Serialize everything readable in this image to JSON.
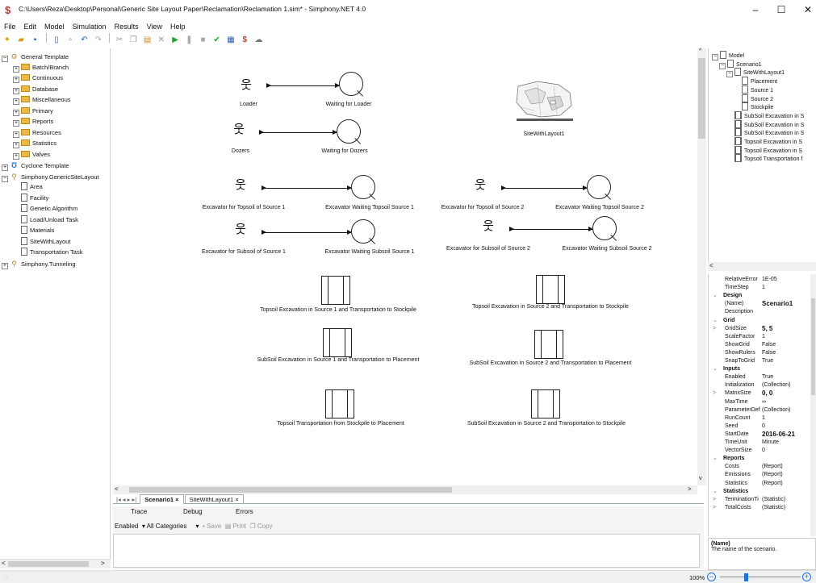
{
  "title": {
    "icon": "simphony-dollar-icon",
    "text": "C:\\Users\\Reza\\Desktop\\Personal\\Generic Site Layout Paper\\Reclamation\\Reclamation 1.sim* - Simphony.NET 4.0",
    "minimize": "–",
    "maximize": "☐",
    "close": "✕"
  },
  "menu": [
    "File",
    "Edit",
    "Model",
    "Simulation",
    "Results",
    "View",
    "Help"
  ],
  "toolbar": {
    "icons": [
      "new-file-icon",
      "open-folder-icon",
      "save-icon",
      "add-element-icon",
      "page-icon",
      "undo-icon",
      "redo-icon",
      "cut-icon",
      "copy-icon",
      "paste-icon",
      "delete-icon",
      "run-icon",
      "pause-icon",
      "stop-icon",
      "check-icon",
      "report-icon",
      "dollar-icon",
      "cloud-icon"
    ]
  },
  "left_tree": [
    {
      "label": "General Template",
      "icon": "template-icon",
      "exp": "−",
      "level": 0
    },
    {
      "label": "Batch/Branch",
      "icon": "folder-icon",
      "exp": "+",
      "level": 1
    },
    {
      "label": "Continuous",
      "icon": "folder-icon",
      "exp": "+",
      "level": 1
    },
    {
      "label": "Database",
      "icon": "folder-icon",
      "exp": "+",
      "level": 1
    },
    {
      "label": "Miscellaneous",
      "icon": "folder-icon",
      "exp": "+",
      "level": 1
    },
    {
      "label": "Primary",
      "icon": "folder-icon",
      "exp": "+",
      "level": 1
    },
    {
      "label": "Reports",
      "icon": "folder-icon",
      "exp": "+",
      "level": 1
    },
    {
      "label": "Resources",
      "icon": "folder-icon",
      "exp": "+",
      "level": 1
    },
    {
      "label": "Statistics",
      "icon": "folder-icon",
      "exp": "+",
      "level": 1
    },
    {
      "label": "Valves",
      "icon": "folder-icon",
      "exp": "+",
      "level": 1
    },
    {
      "label": "Cyclone Template",
      "icon": "cyclone-icon",
      "exp": "+",
      "level": 0
    },
    {
      "label": "Simphony.GenericSiteLayout",
      "icon": "plugin-icon",
      "exp": "−",
      "level": 0
    },
    {
      "label": "Area",
      "icon": "document-icon",
      "exp": "",
      "level": 1
    },
    {
      "label": "Facility",
      "icon": "document-icon",
      "exp": "",
      "level": 1
    },
    {
      "label": "Genetic Algorithm",
      "icon": "document-icon",
      "exp": "",
      "level": 1
    },
    {
      "label": "Load/Unload Task",
      "icon": "document-icon",
      "exp": "",
      "level": 1
    },
    {
      "label": "Materials",
      "icon": "document-icon",
      "exp": "",
      "level": 1
    },
    {
      "label": "SiteWithLayout",
      "icon": "document-icon",
      "exp": "",
      "level": 1
    },
    {
      "label": "Transportation Task",
      "icon": "document-icon",
      "exp": "",
      "level": 1
    },
    {
      "label": "Simphony.Tunneling",
      "icon": "plugin-icon",
      "exp": "+",
      "level": 0
    }
  ],
  "canvas": {
    "resources": [
      {
        "label": "Loader",
        "queue": "Waiting for Loader"
      },
      {
        "label": "Dozers",
        "queue": "Waiting for Dozers"
      },
      {
        "label": "Excavator for Topsoil of Source 1",
        "queue": "Excavator Waiting Topsoil Source 1"
      },
      {
        "label": "Excavator for Subsoil of Source 1",
        "queue": "Excavator Waiting Subsoil Source 1"
      },
      {
        "label": "Excavator for Topsoil of Source 2",
        "queue": "Excavator Waiting Topsoil Source 2"
      },
      {
        "label": "Excavator for Subsoil of Source 2",
        "queue": "Excavator Waiting Subsoil Source 2"
      }
    ],
    "site_label": "SiteWithLayout1",
    "tasks": [
      "Topsoil Excavation in Source 1 and Transportation to Stockpile",
      "Topsoil Excavation in Source 2 and Transportation to Stockpile",
      "SubSoil Excavation in Source 1 and Transportation to Placement",
      "SubSoil Excavation in Source 2 and Transportation to Placement",
      "Topsoil Transportation from Stockpile to Placement",
      "SubSoil Excavation in Source 2 and Transportation to Stockpile"
    ]
  },
  "doc_tabs": {
    "nav": "|◂ ◂ ▸ ▸|",
    "tabs": [
      {
        "label": "Scenario1",
        "close": "×",
        "active": true
      },
      {
        "label": "SiteWithLayout1",
        "close": "×",
        "active": false
      }
    ]
  },
  "bottom": {
    "tabs": [
      "Trace",
      "Debug",
      "Errors"
    ],
    "enabled_label": "Enabled",
    "category_label": "All Categories",
    "save_label": "Save",
    "print_label": "Print",
    "copy_label": "Copy"
  },
  "model_tree": [
    {
      "label": "Model",
      "exp": "−",
      "icon": "document-icon",
      "level": 0
    },
    {
      "label": "Scenario1",
      "exp": "−",
      "icon": "document-icon",
      "level": 1
    },
    {
      "label": "SiteWithLayout1",
      "exp": "−",
      "icon": "document-icon",
      "level": 2
    },
    {
      "label": "Placement",
      "exp": "",
      "icon": "document-icon",
      "level": 3
    },
    {
      "label": "Source 1",
      "exp": "",
      "icon": "document-icon",
      "level": 3
    },
    {
      "label": "Source 2",
      "exp": "",
      "icon": "document-icon",
      "level": 3
    },
    {
      "label": "Stockpile",
      "exp": "",
      "icon": "document-icon",
      "level": 3
    },
    {
      "label": "SubSoil Excavation in S",
      "exp": "",
      "icon": "task-icon",
      "level": 2
    },
    {
      "label": "SubSoil Excavation in S",
      "exp": "",
      "icon": "task-icon",
      "level": 2
    },
    {
      "label": "SubSoil Excavation in S",
      "exp": "",
      "icon": "task-icon",
      "level": 2
    },
    {
      "label": "Topsoil Excavation in S",
      "exp": "",
      "icon": "task-icon",
      "level": 2
    },
    {
      "label": "Topsoil Excavation in S",
      "exp": "",
      "icon": "task-icon",
      "level": 2
    },
    {
      "label": "Topsoil Transportation f",
      "exp": "",
      "icon": "task-icon",
      "level": 2
    }
  ],
  "properties": [
    {
      "type": "prop",
      "name": "RelativeError",
      "value": "1E-05"
    },
    {
      "type": "prop",
      "name": "TimeStep",
      "value": "1"
    },
    {
      "type": "cat",
      "name": "Design"
    },
    {
      "type": "prop",
      "name": "(Name)",
      "value": "Scenario1",
      "bold": true
    },
    {
      "type": "prop",
      "name": "Description",
      "value": ""
    },
    {
      "type": "cat",
      "name": "Grid"
    },
    {
      "type": "prop",
      "name": "GridSize",
      "value": "5, 5",
      "bold": true,
      "expand": ">"
    },
    {
      "type": "prop",
      "name": "ScaleFactor",
      "value": "1"
    },
    {
      "type": "prop",
      "name": "ShowGrid",
      "value": "False"
    },
    {
      "type": "prop",
      "name": "ShowRulers",
      "value": "False"
    },
    {
      "type": "prop",
      "name": "SnapToGrid",
      "value": "True"
    },
    {
      "type": "cat",
      "name": "Inputs"
    },
    {
      "type": "prop",
      "name": "Enabled",
      "value": "True"
    },
    {
      "type": "prop",
      "name": "Initialization",
      "value": "(Collection)"
    },
    {
      "type": "prop",
      "name": "MatrixSize",
      "value": "0, 0",
      "bold": true,
      "expand": ">"
    },
    {
      "type": "prop",
      "name": "MaxTime",
      "value": "∞"
    },
    {
      "type": "prop",
      "name": "ParameterDef",
      "value": "(Collection)"
    },
    {
      "type": "prop",
      "name": "RunCount",
      "value": "1"
    },
    {
      "type": "prop",
      "name": "Seed",
      "value": "0"
    },
    {
      "type": "prop",
      "name": "StartDate",
      "value": "2016-06-21",
      "bold": true
    },
    {
      "type": "prop",
      "name": "TimeUnit",
      "value": "Minute"
    },
    {
      "type": "prop",
      "name": "VectorSize",
      "value": "0"
    },
    {
      "type": "cat",
      "name": "Reports"
    },
    {
      "type": "prop",
      "name": "Costs",
      "value": "(Report)"
    },
    {
      "type": "prop",
      "name": "Emissions",
      "value": "(Report)"
    },
    {
      "type": "prop",
      "name": "Statistics",
      "value": "(Report)"
    },
    {
      "type": "cat",
      "name": "Statistics"
    },
    {
      "type": "prop",
      "name": "TerminationTi",
      "value": "(Statistic)",
      "expand": ">"
    },
    {
      "type": "prop",
      "name": "TotalCosts",
      "value": "(Statistic)",
      "expand": ">"
    }
  ],
  "prop_desc": {
    "title": "(Name)",
    "text": "The name of the scenario."
  },
  "status": {
    "zoom": "100%",
    "zoom_out": "−",
    "zoom_in": "+",
    "zoom_level": 0.3
  },
  "colors": {
    "accent": "#1e73d6",
    "folder": "#e9b949",
    "title_icon": "#c0392b"
  }
}
